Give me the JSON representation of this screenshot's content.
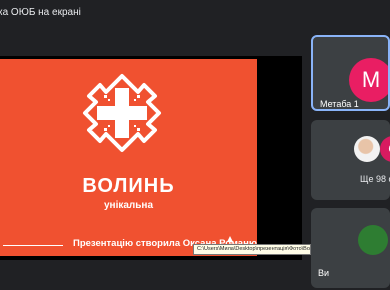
{
  "window": {
    "title": "ка ОЮБ на екрані"
  },
  "presentation": {
    "brand_main": "ВОЛИНЬ",
    "brand_sub": "унікальна",
    "credit": "Презентацію створила Оксана Романюк",
    "path_tooltip": "C:\\Users\\Мила\\Desktop\\презентація\\Фото\\Волинь\\Волинь.jpg",
    "accent": "#f05130"
  },
  "participants": [
    {
      "name": "Метаба 1",
      "initial": "М",
      "color": "#e91e63",
      "active": true
    },
    {
      "more_label": "Ще 98 ос",
      "initial": "С",
      "color": "#d81b60"
    },
    {
      "name": "Ви",
      "color": "#2e7d32"
    }
  ]
}
